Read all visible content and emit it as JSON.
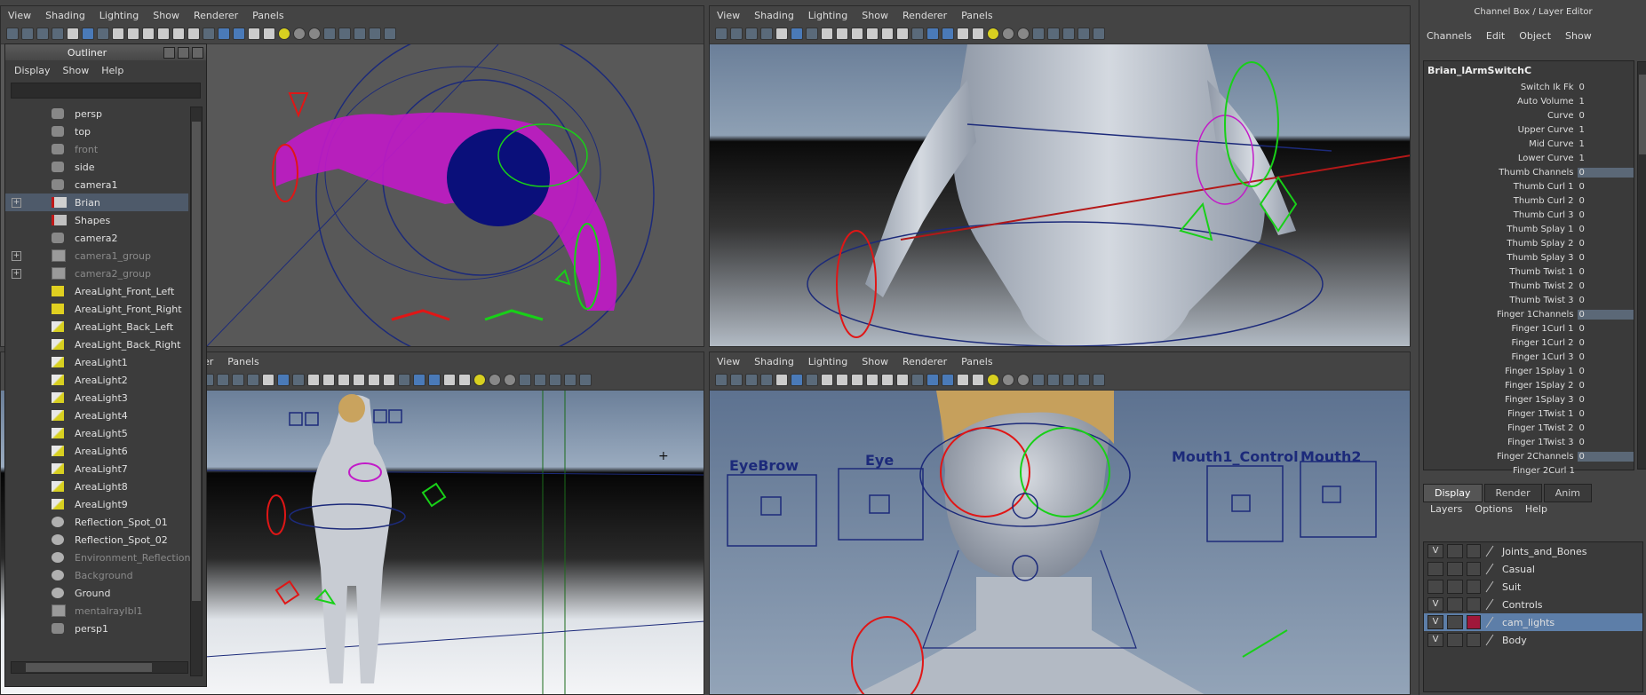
{
  "viewport_menu": [
    "View",
    "Shading",
    "Lighting",
    "Show",
    "Renderer",
    "Panels"
  ],
  "viewport_menu_partial": [
    "er",
    "Panels"
  ],
  "outliner": {
    "title": "Outliner",
    "menu": [
      "Display",
      "Show",
      "Help"
    ],
    "items": [
      {
        "label": "persp",
        "icon": "camera-icon",
        "dim": false,
        "expand": false
      },
      {
        "label": "top",
        "icon": "camera-icon",
        "dim": false,
        "expand": false
      },
      {
        "label": "front",
        "icon": "camera-icon",
        "dim": true,
        "expand": false
      },
      {
        "label": "side",
        "icon": "camera-icon",
        "dim": false,
        "expand": false
      },
      {
        "label": "camera1",
        "icon": "camera-icon",
        "dim": false,
        "expand": false
      },
      {
        "label": "Brian",
        "icon": "character-icon",
        "dim": false,
        "expand": true,
        "selected": true
      },
      {
        "label": "Shapes",
        "icon": "blendshape-icon",
        "dim": false,
        "expand": false
      },
      {
        "label": "camera2",
        "icon": "camera-icon",
        "dim": false,
        "expand": false
      },
      {
        "label": "camera1_group",
        "icon": "group-icon",
        "dim": true,
        "expand": true
      },
      {
        "label": "camera2_group",
        "icon": "group-icon",
        "dim": true,
        "expand": true
      },
      {
        "label": "AreaLight_Front_Left",
        "icon": "area-light-icon",
        "dim": false,
        "expand": false
      },
      {
        "label": "AreaLight_Front_Right",
        "icon": "area-light-icon",
        "dim": false,
        "expand": false
      },
      {
        "label": "AreaLight_Back_Left",
        "icon": "light-icon",
        "dim": false,
        "expand": false
      },
      {
        "label": "AreaLight_Back_Right",
        "icon": "light-icon",
        "dim": false,
        "expand": false
      },
      {
        "label": "AreaLight1",
        "icon": "light-icon",
        "dim": false,
        "expand": false
      },
      {
        "label": "AreaLight2",
        "icon": "light-icon",
        "dim": false,
        "expand": false
      },
      {
        "label": "AreaLight3",
        "icon": "light-icon",
        "dim": false,
        "expand": false
      },
      {
        "label": "AreaLight4",
        "icon": "light-icon",
        "dim": false,
        "expand": false
      },
      {
        "label": "AreaLight5",
        "icon": "light-icon",
        "dim": false,
        "expand": false
      },
      {
        "label": "AreaLight6",
        "icon": "light-icon",
        "dim": false,
        "expand": false
      },
      {
        "label": "AreaLight7",
        "icon": "light-icon",
        "dim": false,
        "expand": false
      },
      {
        "label": "AreaLight8",
        "icon": "light-icon",
        "dim": false,
        "expand": false
      },
      {
        "label": "AreaLight9",
        "icon": "light-icon",
        "dim": false,
        "expand": false
      },
      {
        "label": "Reflection_Spot_01",
        "icon": "spot-icon",
        "dim": false,
        "expand": false
      },
      {
        "label": "Reflection_Spot_02",
        "icon": "spot-icon",
        "dim": false,
        "expand": false
      },
      {
        "label": "Environment_Reflection",
        "icon": "spot-icon",
        "dim": true,
        "expand": false
      },
      {
        "label": "Background",
        "icon": "spot-icon",
        "dim": true,
        "expand": false
      },
      {
        "label": "Ground",
        "icon": "spot-icon",
        "dim": false,
        "expand": false
      },
      {
        "label": "mentalrayIbl1",
        "icon": "group-icon",
        "dim": true,
        "expand": false
      },
      {
        "label": "persp1",
        "icon": "camera-icon",
        "dim": false,
        "expand": false
      }
    ]
  },
  "channel_box": {
    "title": "Channel Box / Layer Editor",
    "menu": [
      "Channels",
      "Edit",
      "Object",
      "Show"
    ],
    "node": "Brian_lArmSwitchC",
    "channels": [
      {
        "name": "Switch Ik Fk",
        "value": "0",
        "hl": false
      },
      {
        "name": "Auto Volume",
        "value": "1",
        "hl": false
      },
      {
        "name": "Curve",
        "value": "0",
        "hl": false
      },
      {
        "name": "Upper Curve",
        "value": "1",
        "hl": false
      },
      {
        "name": "Mid Curve",
        "value": "1",
        "hl": false
      },
      {
        "name": "Lower Curve",
        "value": "1",
        "hl": false
      },
      {
        "name": "Thumb Channels",
        "value": "0",
        "hl": true
      },
      {
        "name": "Thumb Curl 1",
        "value": "0",
        "hl": false
      },
      {
        "name": "Thumb Curl 2",
        "value": "0",
        "hl": false
      },
      {
        "name": "Thumb Curl 3",
        "value": "0",
        "hl": false
      },
      {
        "name": "Thumb Splay 1",
        "value": "0",
        "hl": false
      },
      {
        "name": "Thumb Splay 2",
        "value": "0",
        "hl": false
      },
      {
        "name": "Thumb Splay 3",
        "value": "0",
        "hl": false
      },
      {
        "name": "Thumb Twist 1",
        "value": "0",
        "hl": false
      },
      {
        "name": "Thumb Twist 2",
        "value": "0",
        "hl": false
      },
      {
        "name": "Thumb Twist 3",
        "value": "0",
        "hl": false
      },
      {
        "name": "Finger 1Channels",
        "value": "0",
        "hl": true
      },
      {
        "name": "Finger 1Curl 1",
        "value": "0",
        "hl": false
      },
      {
        "name": "Finger 1Curl 2",
        "value": "0",
        "hl": false
      },
      {
        "name": "Finger 1Curl 3",
        "value": "0",
        "hl": false
      },
      {
        "name": "Finger 1Splay 1",
        "value": "0",
        "hl": false
      },
      {
        "name": "Finger 1Splay 2",
        "value": "0",
        "hl": false
      },
      {
        "name": "Finger 1Splay 3",
        "value": "0",
        "hl": false
      },
      {
        "name": "Finger 1Twist 1",
        "value": "0",
        "hl": false
      },
      {
        "name": "Finger 1Twist 2",
        "value": "0",
        "hl": false
      },
      {
        "name": "Finger 1Twist 3",
        "value": "0",
        "hl": false
      },
      {
        "name": "Finger 2Channels",
        "value": "0",
        "hl": true
      }
    ],
    "channel_partial": "Finger 2Curl 1"
  },
  "layer_editor": {
    "tabs": [
      "Display",
      "Render",
      "Anim"
    ],
    "menu": [
      "Layers",
      "Options",
      "Help"
    ],
    "layers": [
      {
        "name": "Joints_and_Bones",
        "visible": "V",
        "color": "",
        "selected": false
      },
      {
        "name": "Casual",
        "visible": "",
        "color": "",
        "selected": false
      },
      {
        "name": "Suit",
        "visible": "",
        "color": "",
        "selected": false
      },
      {
        "name": "Controls",
        "visible": "V",
        "color": "",
        "selected": false
      },
      {
        "name": "cam_lights",
        "visible": "V",
        "color": "#a0183a",
        "selected": true
      },
      {
        "name": "Body",
        "visible": "V",
        "color": "",
        "selected": false
      }
    ]
  },
  "face_controls": {
    "eyebrow": "EyeBrow",
    "eye": "Eye",
    "mouth1": "Mouth1_Control",
    "mouth2": "Mouth2"
  }
}
